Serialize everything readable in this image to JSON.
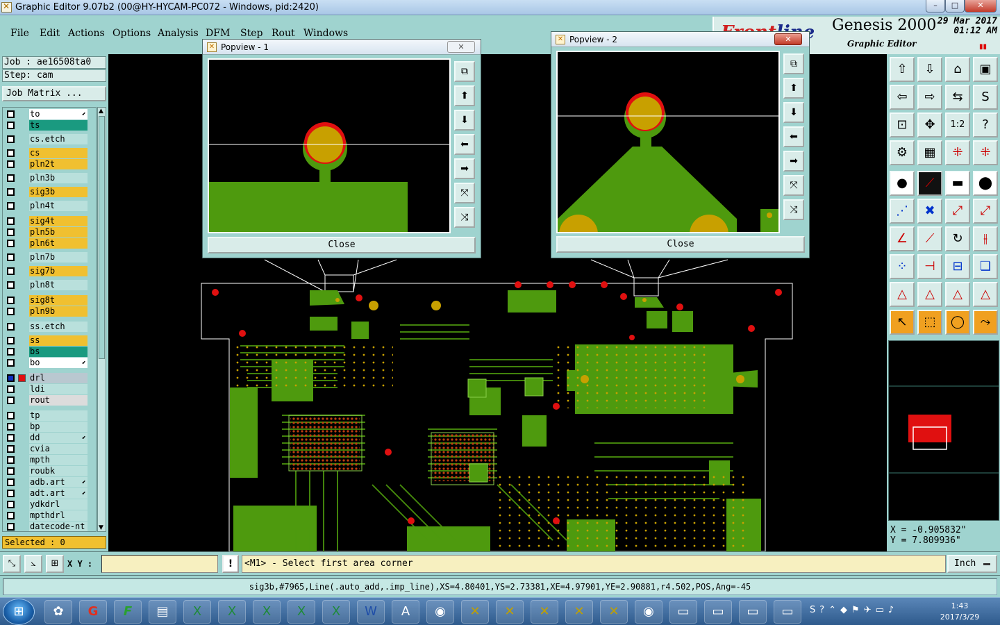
{
  "window": {
    "title": "Graphic Editor 9.07b2 (00@HY-HYCAM-PC072 - Windows, pid:2420)",
    "min": "–",
    "max": "□",
    "close": "✕"
  },
  "menu": [
    "File",
    "Edit",
    "Actions",
    "Options",
    "Analysis",
    "DFM",
    "Step",
    "Rout",
    "Windows"
  ],
  "brand": {
    "logo_a": "Front",
    "logo_b": "line",
    "product": "Genesis 2000",
    "subtitle": "Graphic Editor",
    "date": "29 Mar 2017",
    "time": "01:12 AM"
  },
  "job": {
    "label": "Job : ae16508ta0",
    "step": "Step: cam",
    "matrix": "Job Matrix ..."
  },
  "layers": [
    {
      "name": "to",
      "color": "#ffffff",
      "arrow": true
    },
    {
      "name": "ts",
      "color": "#1a9a80",
      "arrow": false
    },
    {
      "name": "cs.etch",
      "color": "#b9e0dc",
      "arrow": false
    },
    {
      "name": "cs",
      "color": "#f0c030",
      "arrow": false
    },
    {
      "name": "pln2t",
      "color": "#f0c030",
      "arrow": false
    },
    {
      "name": "pln3b",
      "color": "#b9e0dc",
      "arrow": false
    },
    {
      "name": "sig3b",
      "color": "#f0c030",
      "arrow": false
    },
    {
      "name": "pln4t",
      "color": "#b9e0dc",
      "arrow": false
    },
    {
      "name": "sig4t",
      "color": "#f0c030",
      "arrow": false
    },
    {
      "name": "pln5b",
      "color": "#f0c030",
      "arrow": false
    },
    {
      "name": "pln6t",
      "color": "#f0c030",
      "arrow": false
    },
    {
      "name": "pln7b",
      "color": "#b9e0dc",
      "arrow": false
    },
    {
      "name": "sig7b",
      "color": "#f0c030",
      "arrow": false
    },
    {
      "name": "pln8t",
      "color": "#b9e0dc",
      "arrow": false
    },
    {
      "name": "sig8t",
      "color": "#f0c030",
      "arrow": false
    },
    {
      "name": "pln9b",
      "color": "#f0c030",
      "arrow": false
    },
    {
      "name": "ss.etch",
      "color": "#b9e0dc",
      "arrow": false
    },
    {
      "name": "ss",
      "color": "#f0c030",
      "arrow": false
    },
    {
      "name": "bs",
      "color": "#1a9a80",
      "arrow": false
    },
    {
      "name": "bo",
      "color": "#ffffff",
      "arrow": true
    },
    {
      "name": "drl",
      "color": "#b9c8d0",
      "arrow": false
    },
    {
      "name": "ldi",
      "color": "#b9e0dc",
      "arrow": false
    },
    {
      "name": "rout",
      "color": "#dcdcdc",
      "arrow": false
    },
    {
      "name": "tp",
      "color": "#b9e0dc",
      "arrow": false
    },
    {
      "name": "bp",
      "color": "#b9e0dc",
      "arrow": false
    },
    {
      "name": "dd",
      "color": "#b9e0dc",
      "arrow": true
    },
    {
      "name": "cvia",
      "color": "#b9e0dc",
      "arrow": false
    },
    {
      "name": "mpth",
      "color": "#b9e0dc",
      "arrow": false
    },
    {
      "name": "roubk",
      "color": "#b9e0dc",
      "arrow": false
    },
    {
      "name": "adb.art",
      "color": "#b9e0dc",
      "arrow": true
    },
    {
      "name": "adt.art",
      "color": "#b9e0dc",
      "arrow": true
    },
    {
      "name": "ydkdrl",
      "color": "#b9e0dc",
      "arrow": false
    },
    {
      "name": "mpthdrl",
      "color": "#b9e0dc",
      "arrow": false
    },
    {
      "name": "datecode-nt",
      "color": "#b9e0dc",
      "arrow": false
    }
  ],
  "selected": "Selected : 0",
  "popview1": {
    "title": "Popview - 1",
    "close": "Close",
    "closex": "✕"
  },
  "popview2": {
    "title": "Popview - 2",
    "close": "Close",
    "closex": "✕"
  },
  "coords": {
    "x": "X = -0.905832\"",
    "y": "Y = 7.809936\""
  },
  "cmd": {
    "xy_label": "X Y :",
    "prompt": "<M1> - Select first area corner",
    "units": "Inch",
    "warn": "!"
  },
  "status": "sig3b,#7965,Line(.auto_add,.imp_line),XS=4.80401,YS=2.73381,XE=4.97901,YE=2.90881,r4.502,POS,Ang=-45",
  "taskbar": {
    "clock_time": "1:43",
    "clock_date": "2017/3/29"
  },
  "colors": {
    "copper": "#4e9a0e",
    "pad": "#c8a000",
    "red": "#e01010",
    "panel": "#9fd3cf"
  }
}
